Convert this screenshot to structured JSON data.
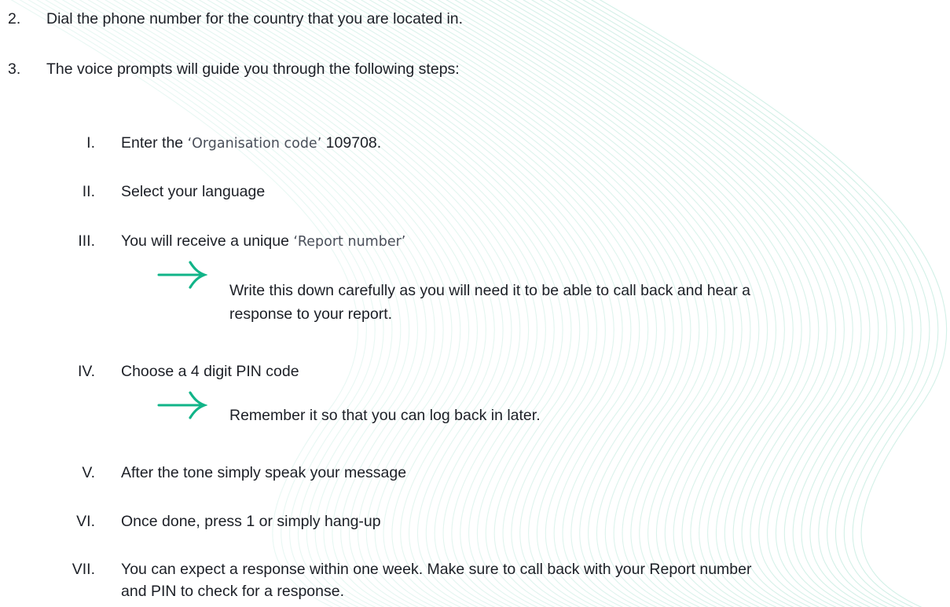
{
  "colors": {
    "text": "#1c1f26",
    "accent": "#11b488",
    "wave": "#cdeee4"
  },
  "steps": [
    {
      "number": "2.",
      "text": "Dial the phone number for the country that you are located in."
    },
    {
      "number": "3.",
      "text": "The voice prompts will guide you through the following steps:"
    }
  ],
  "substeps": [
    {
      "numeral": "I.",
      "text_before": "Enter the ",
      "quoted": "‘Organisation code’",
      "text_after": " 109708."
    },
    {
      "numeral": "II.",
      "text": "Select your language"
    },
    {
      "numeral": "III.",
      "text_before": "You will receive a unique ",
      "quoted": "‘Report number’",
      "note_lines": [
        "Write this down carefully as you will need it to be able to call back and hear a",
        "response to your report."
      ],
      "note_icon": "arrow-right-icon"
    },
    {
      "numeral": "IV.",
      "text": "Choose a 4 digit PIN code",
      "note_lines": [
        "Remember it so that you can log back in later."
      ],
      "note_icon": "arrow-right-icon"
    },
    {
      "numeral": "V.",
      "text": "After the tone simply speak your message"
    },
    {
      "numeral": "VI.",
      "text": "Once done, press 1 or simply hang-up"
    },
    {
      "numeral": "VII.",
      "lines": [
        "You can expect a response within one week. Make sure to call back with your Report number",
        "and PIN to check for a response."
      ]
    }
  ]
}
